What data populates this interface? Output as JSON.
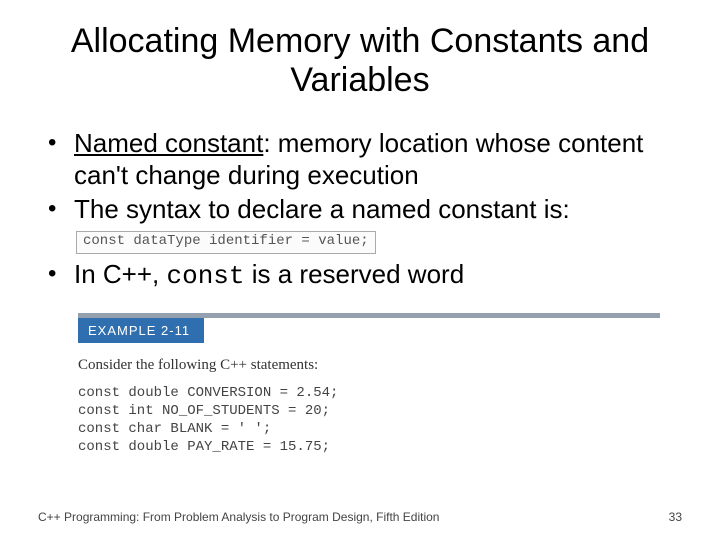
{
  "title": "Allocating Memory with Constants and Variables",
  "bullets": {
    "b1_lead": "Named constant",
    "b1_rest": ": memory location whose content can't change during execution",
    "b2": "The syntax to declare a named constant is:",
    "b2_syntax": "const dataType identifier = value;",
    "b3_pre": "In C++, ",
    "b3_code": "const",
    "b3_post": " is a reserved word"
  },
  "example": {
    "label": "EXAMPLE 2-11",
    "intro": "Consider the following C++ statements:",
    "code": "const double CONVERSION = 2.54;\nconst int NO_OF_STUDENTS = 20;\nconst char BLANK = ' ';\nconst double PAY_RATE = 15.75;"
  },
  "footer": "C++ Programming: From Problem Analysis to Program Design, Fifth Edition",
  "page_number": "33"
}
